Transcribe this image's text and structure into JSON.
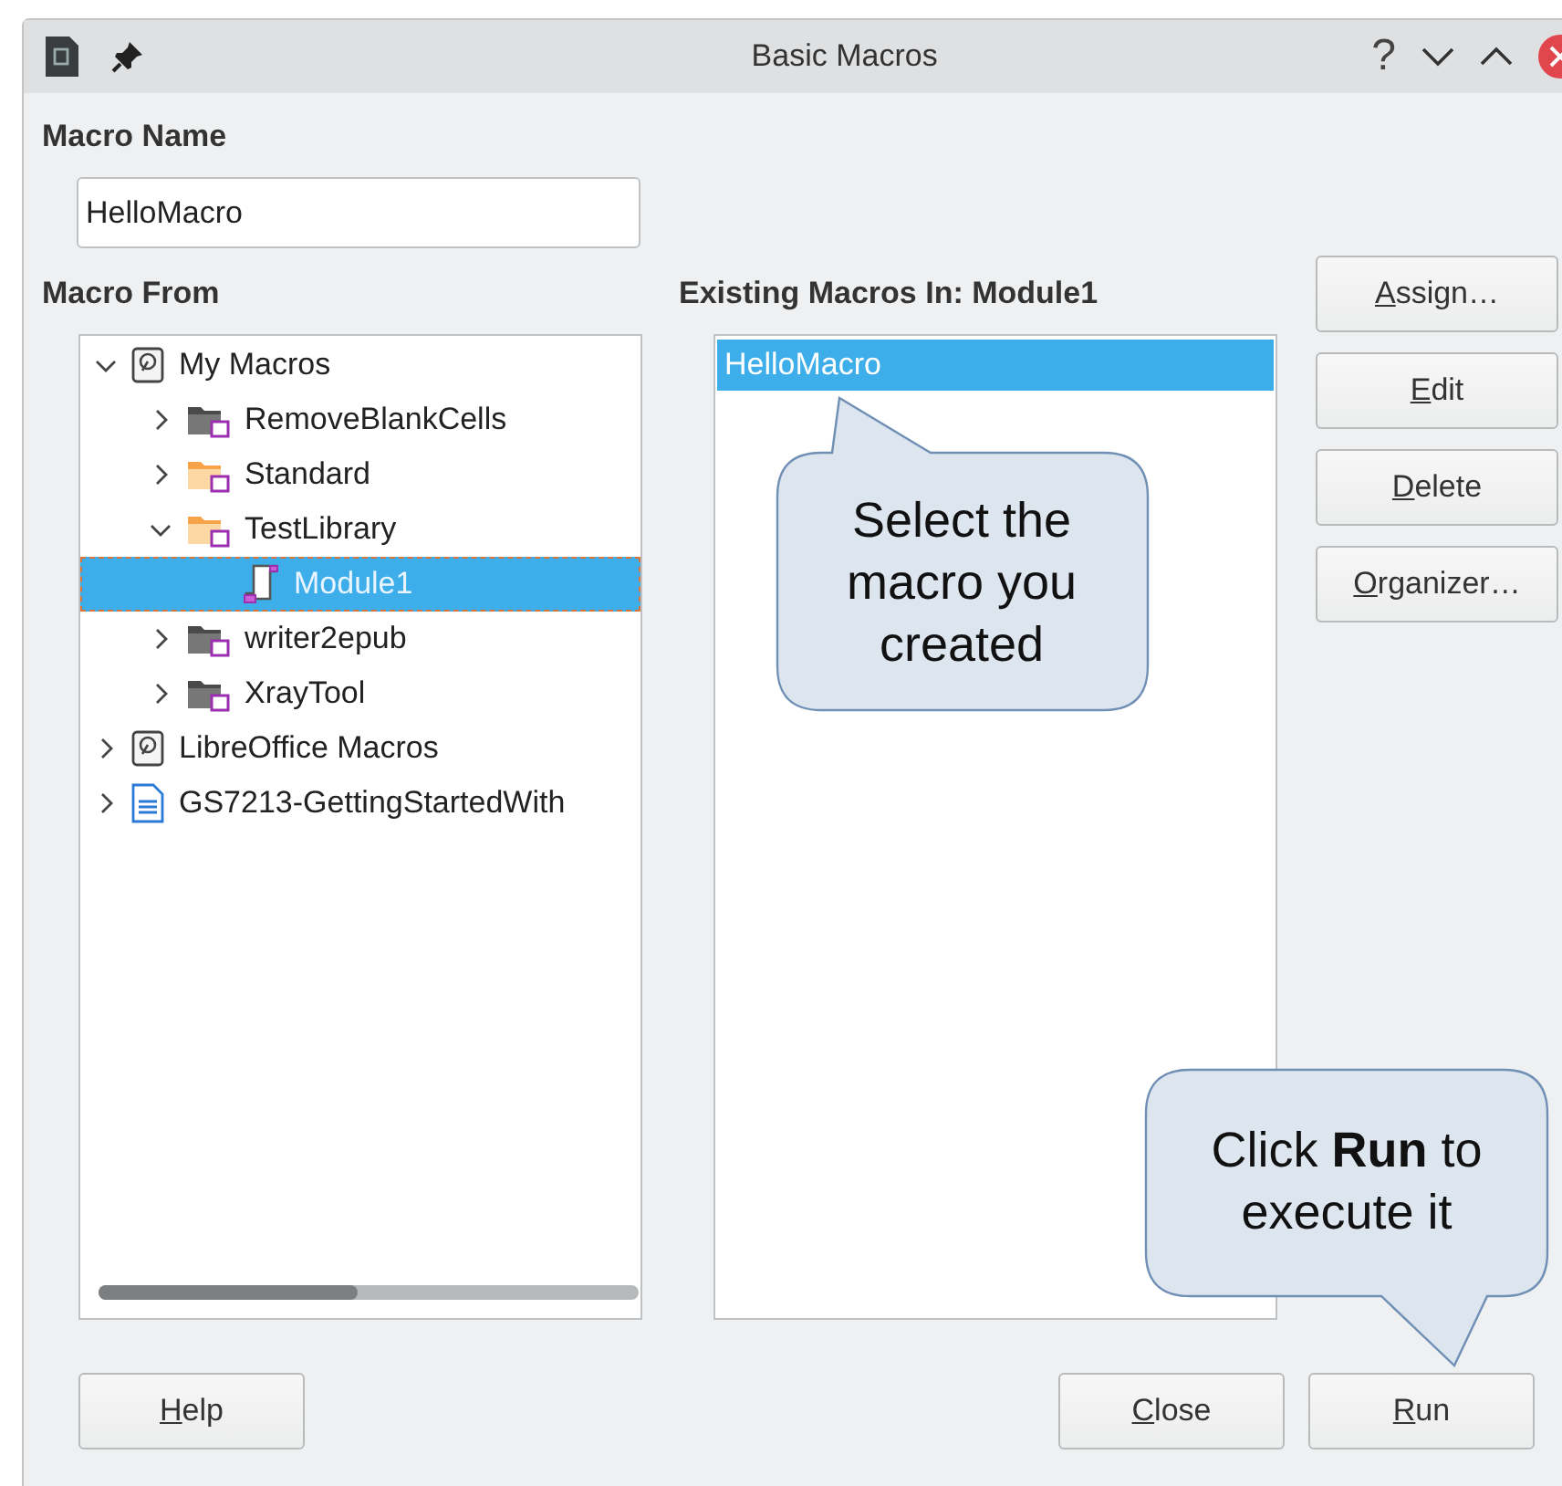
{
  "window": {
    "title": "Basic Macros",
    "help_symbol": "?"
  },
  "macro_name": {
    "label": "Macro Name",
    "value": "HelloMacro"
  },
  "macro_from": {
    "label": "Macro From",
    "items": [
      {
        "label": "My Macros",
        "kind": "container",
        "expanded": true,
        "selected": false,
        "children": [
          {
            "label": "RemoveBlankCells",
            "kind": "extension-library",
            "expanded": false,
            "selected": false
          },
          {
            "label": "Standard",
            "kind": "library",
            "expanded": false,
            "selected": false
          },
          {
            "label": "TestLibrary",
            "kind": "library",
            "expanded": true,
            "selected": false,
            "children": [
              {
                "label": "Module1",
                "kind": "module",
                "selected": true
              }
            ]
          },
          {
            "label": "writer2epub",
            "kind": "extension-library",
            "expanded": false,
            "selected": false
          },
          {
            "label": "XrayTool",
            "kind": "extension-library",
            "expanded": false,
            "selected": false
          }
        ]
      },
      {
        "label": "LibreOffice Macros",
        "kind": "container",
        "expanded": false,
        "selected": false
      },
      {
        "label": "GS7213-GettingStartedWith",
        "kind": "document",
        "expanded": false,
        "selected": false
      }
    ]
  },
  "existing_macros": {
    "label": "Existing Macros In: Module1",
    "items": [
      {
        "name": "HelloMacro",
        "selected": true
      }
    ]
  },
  "side_buttons": [
    {
      "key": "A",
      "after": "ssign…"
    },
    {
      "key": "E",
      "after": "dit"
    },
    {
      "key": "D",
      "after": "elete"
    },
    {
      "key": "O",
      "after": "rganizer…"
    }
  ],
  "help_button": {
    "key": "H",
    "after": "elp"
  },
  "action_buttons": [
    {
      "key": "C",
      "after": "lose"
    },
    {
      "key": "R",
      "after": "un"
    }
  ],
  "callouts": [
    {
      "text": "Select the\nmacro you\ncreated"
    },
    {
      "text": "Click **Run** to\nexecute it"
    }
  ]
}
